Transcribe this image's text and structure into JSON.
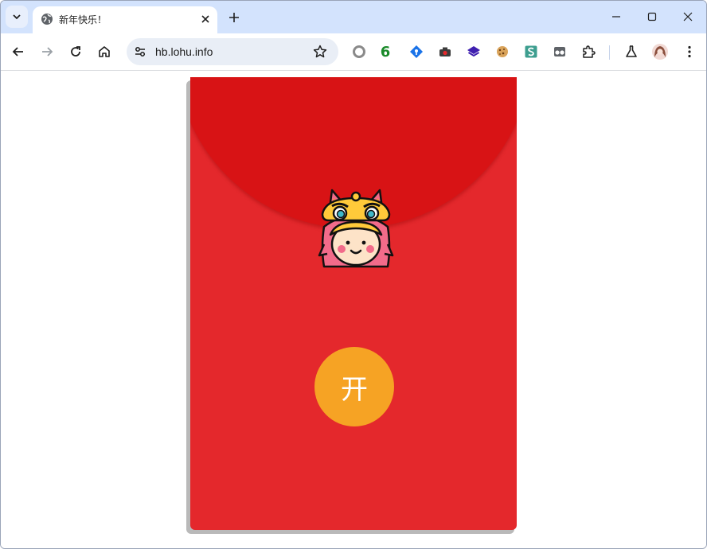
{
  "browser": {
    "tab_title": "新年快乐！",
    "url": "hb.lohu.info",
    "extension_badge": "6"
  },
  "envelope": {
    "open_label": "开",
    "colors": {
      "body": "#e4282c",
      "flap": "#d81315",
      "button": "#f6a324"
    },
    "mascot_icon": "lion-dance-child-icon"
  }
}
